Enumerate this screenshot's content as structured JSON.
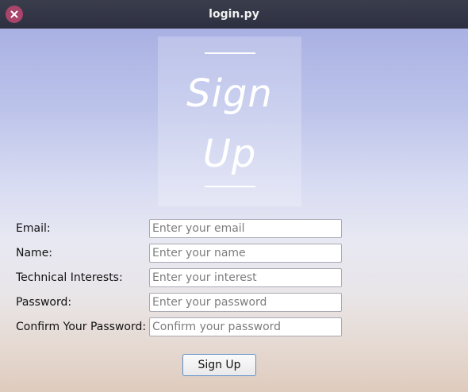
{
  "window": {
    "title": "login.py"
  },
  "logo": {
    "line1": "Sign",
    "line2": "Up"
  },
  "form": {
    "email_label": "Email:",
    "email_placeholder": "Enter your email",
    "name_label": "Name:",
    "name_placeholder": "Enter your name",
    "interests_label": "Technical Interests:",
    "interests_placeholder": "Enter your interest",
    "password_label": "Password:",
    "password_placeholder": "Enter your password",
    "confirm_label": "Confirm Your Password:",
    "confirm_placeholder": "Confirm your password",
    "submit_label": "Sign Up"
  },
  "icons": {
    "close": "close-icon"
  },
  "colors": {
    "close_button": "#a9446a",
    "titlebar": "#2f3240",
    "button_border": "#5e8fc4"
  }
}
